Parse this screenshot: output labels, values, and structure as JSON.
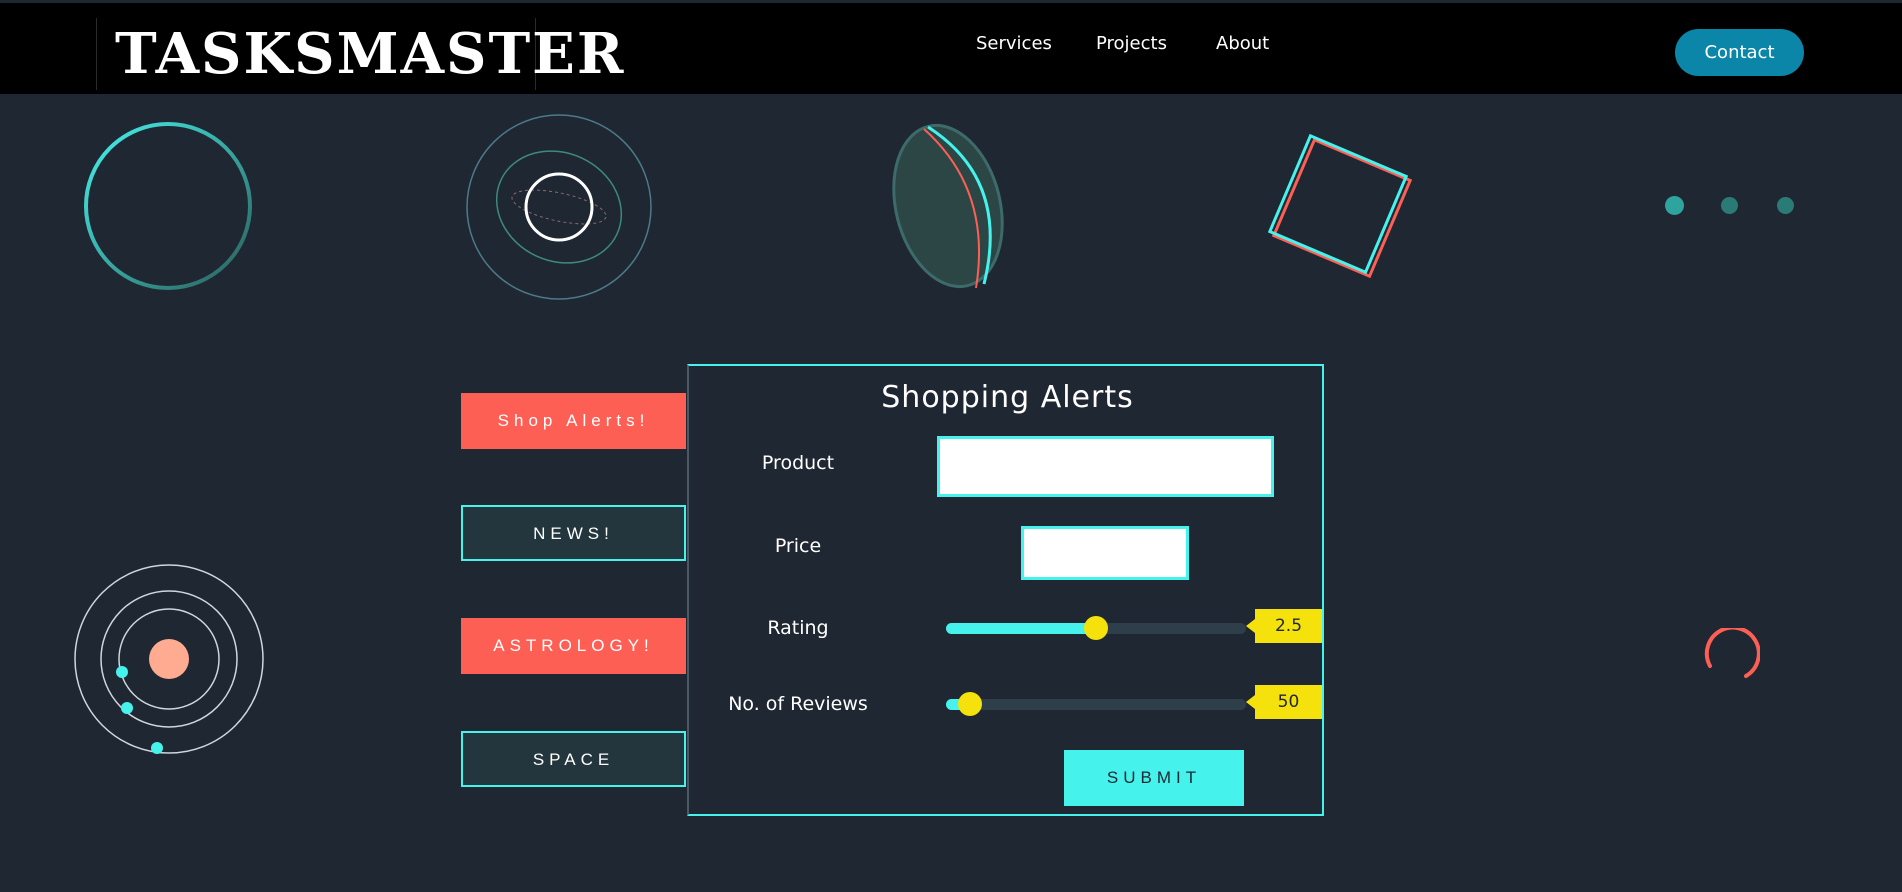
{
  "header": {
    "logo": "TASKSMASTER",
    "nav": [
      "Services",
      "Projects",
      "About"
    ],
    "contact_label": "Contact"
  },
  "side_buttons": [
    "Shop Alerts!",
    "NEWS!",
    "ASTROLOGY!",
    "SPACE"
  ],
  "form": {
    "title": "Shopping Alerts",
    "product_label": "Product",
    "product_value": "",
    "price_label": "Price",
    "price_value": "",
    "rating_label": "Rating",
    "rating_value": "2.5",
    "rating_fraction": 0.5,
    "reviews_label": "No. of Reviews",
    "reviews_value": "50",
    "reviews_fraction": 0.08,
    "submit_label": "SUBMIT"
  },
  "colors": {
    "background": "#1f2732",
    "accent": "#45f3ec",
    "coral": "#fe5f55",
    "slider_thumb": "#f5e10c",
    "contact": "#0b86a8"
  },
  "icons": [
    "ring-icon",
    "planet-orbit-icon",
    "lens-icon",
    "square-icon",
    "loading-dots-icon",
    "solar-system-icon",
    "spinner-icon"
  ]
}
